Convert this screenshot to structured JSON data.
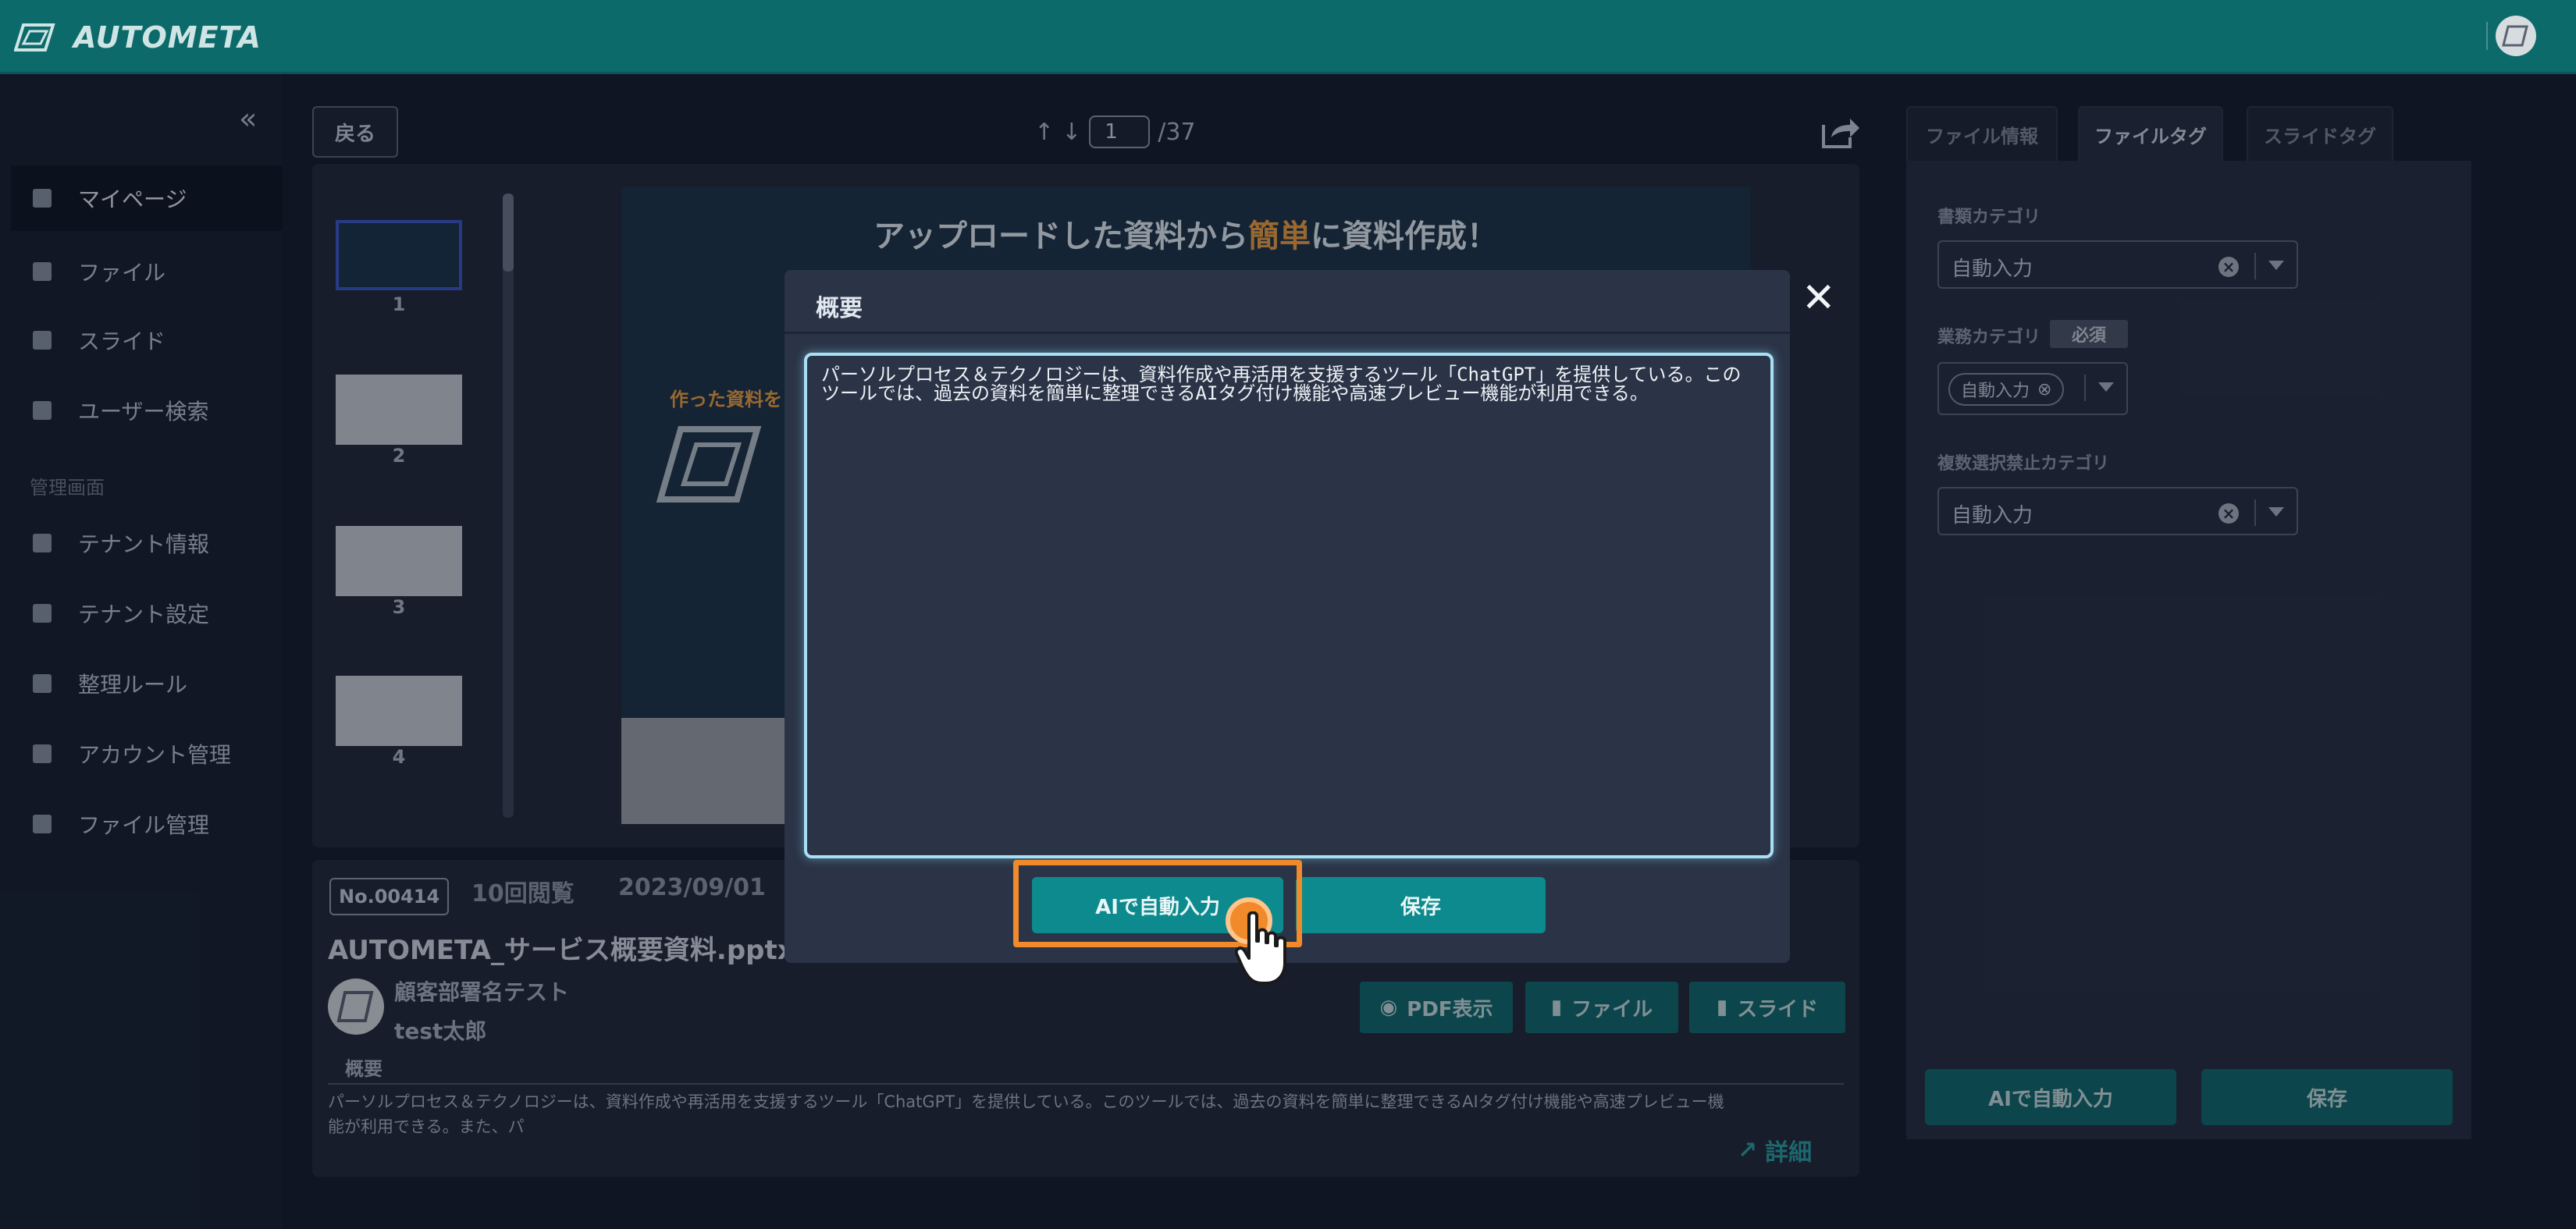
{
  "app": {
    "name": "AUTOMETA"
  },
  "sidebar": {
    "items": [
      {
        "label": "マイページ",
        "icon": "home-icon",
        "active": true
      },
      {
        "label": "ファイル",
        "icon": "file-icon"
      },
      {
        "label": "スライド",
        "icon": "document-icon"
      },
      {
        "label": "ユーザー検索",
        "icon": "user-search-icon"
      }
    ],
    "admin_section": "管理画面",
    "admin_items": [
      {
        "label": "テナント情報",
        "icon": "building-icon"
      },
      {
        "label": "テナント設定",
        "icon": "building-settings-icon"
      },
      {
        "label": "整理ルール",
        "icon": "tools-icon"
      },
      {
        "label": "アカウント管理",
        "icon": "id-card-icon"
      },
      {
        "label": "ファイル管理",
        "icon": "folder-icon"
      }
    ]
  },
  "viewer": {
    "back_label": "戻る",
    "page_current": "1",
    "page_total": "/37",
    "thumbnails": [
      "1",
      "2",
      "3",
      "4"
    ],
    "slide_title_a": "アップロードした資料から",
    "slide_title_hl": "簡単",
    "slide_title_b": "に資料作成！",
    "slide_subtitle": "作った資料を"
  },
  "file": {
    "number": "No.00414",
    "views": "10回閲覧",
    "date": "2023/09/01",
    "title": "AUTOMETA_サービス概要資料.pptx",
    "department": "顧客部署名テスト",
    "user": "test太郎",
    "buttons": {
      "pdf": "PDF表示",
      "file": "ファイル",
      "slide": "スライド"
    },
    "summary_label": "概要",
    "summary_text": "パーソルプロセス＆テクノロジーは、資料作成や再活用を支援するツール「ChatGPT」を提供している。このツールでは、過去の資料を簡単に整理できるAIタグ付け機能や高速プレビュー機能が利用できる。また、パ",
    "detail_label": "詳細"
  },
  "panel": {
    "tabs": [
      "ファイル情報",
      "ファイルタグ",
      "スライドタグ"
    ],
    "active_tab": "ファイルタグ",
    "fields": [
      {
        "label": "書類カテゴリ",
        "value": "自動入力"
      },
      {
        "label": "業務カテゴリ",
        "required": "必須",
        "value": "自動入力"
      },
      {
        "label": "複数選択禁止カテゴリ",
        "value": "自動入力"
      }
    ],
    "ai_button": "AIで自動入力",
    "save_button": "保存"
  },
  "modal": {
    "title": "概要",
    "text": "パーソルプロセス＆テクノロジーは、資料作成や再活用を支援するツール「ChatGPT」を提供している。このツールでは、過去の資料を簡単に整理できるAIタグ付け機能や高速プレビュー機能が利用できる。",
    "ai_button": "AIで自動入力",
    "save_button": "保存",
    "close_glyph": "✕"
  },
  "colors": {
    "topbar": "#0c6a6a",
    "accent": "#0d8a8e",
    "highlight": "#f08a2a"
  }
}
